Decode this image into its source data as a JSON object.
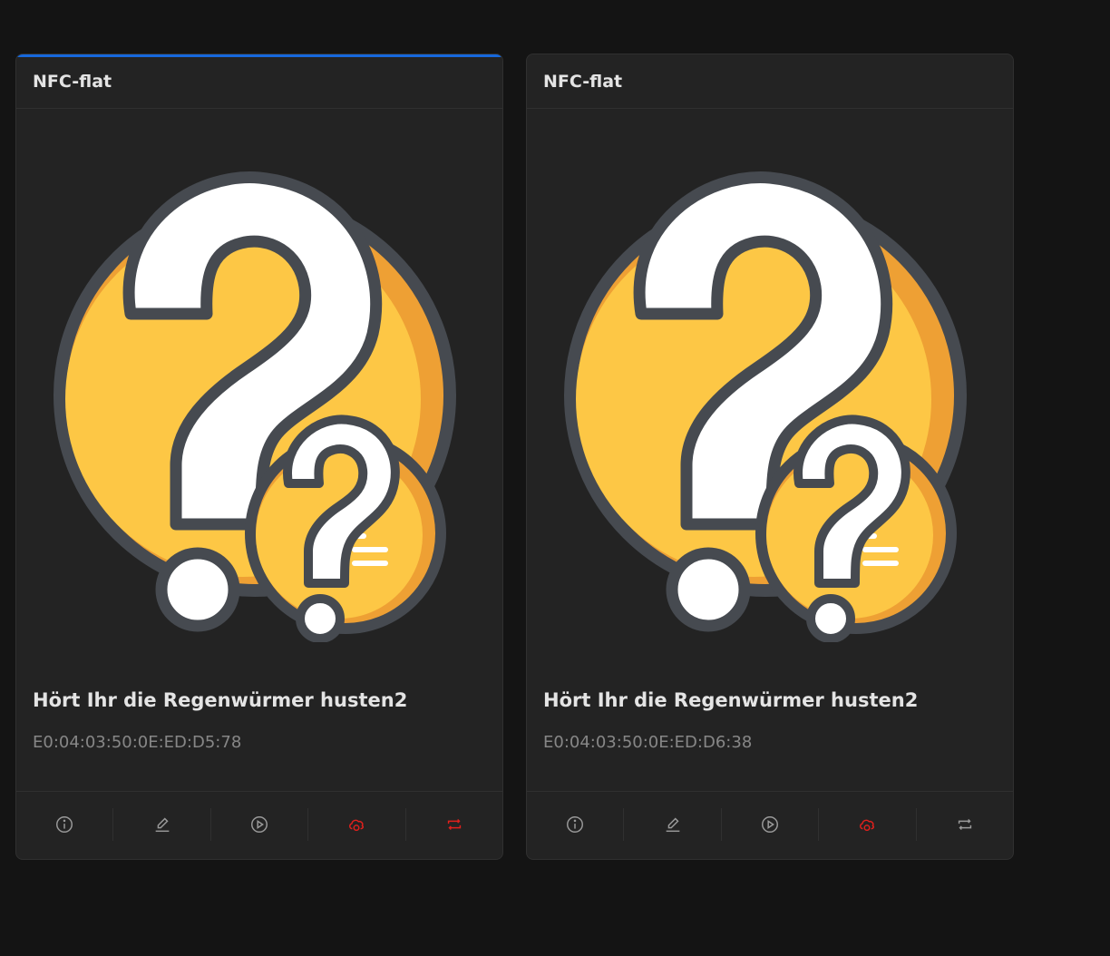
{
  "cards": [
    {
      "header": "NFC-flat",
      "title": "Hört Ihr die Regenwürmer husten2",
      "uid": "E0:04:03:50:0E:ED:D5:78",
      "active": true,
      "actions": [
        {
          "icon": "info-circle-icon",
          "color": "#9a9a9a"
        },
        {
          "icon": "edit-pencil-icon",
          "color": "#9a9a9a"
        },
        {
          "icon": "play-circle-icon",
          "color": "#9a9a9a"
        },
        {
          "icon": "cloud-sync-icon",
          "color": "#e0201c"
        },
        {
          "icon": "retweet-icon",
          "color": "#e0201c"
        }
      ]
    },
    {
      "header": "NFC-flat",
      "title": "Hört Ihr die Regenwürmer husten2",
      "uid": "E0:04:03:50:0E:ED:D6:38",
      "active": false,
      "actions": [
        {
          "icon": "info-circle-icon",
          "color": "#9a9a9a"
        },
        {
          "icon": "edit-pencil-icon",
          "color": "#9a9a9a"
        },
        {
          "icon": "play-circle-icon",
          "color": "#9a9a9a"
        },
        {
          "icon": "cloud-sync-icon",
          "color": "#e0201c"
        },
        {
          "icon": "retweet-icon",
          "color": "#9a9a9a"
        }
      ]
    }
  ],
  "colors": {
    "cover_yellow": "#fdc745",
    "cover_orange": "#eea034",
    "cover_outline": "#464a50",
    "accent_blue": "#1668dc"
  }
}
